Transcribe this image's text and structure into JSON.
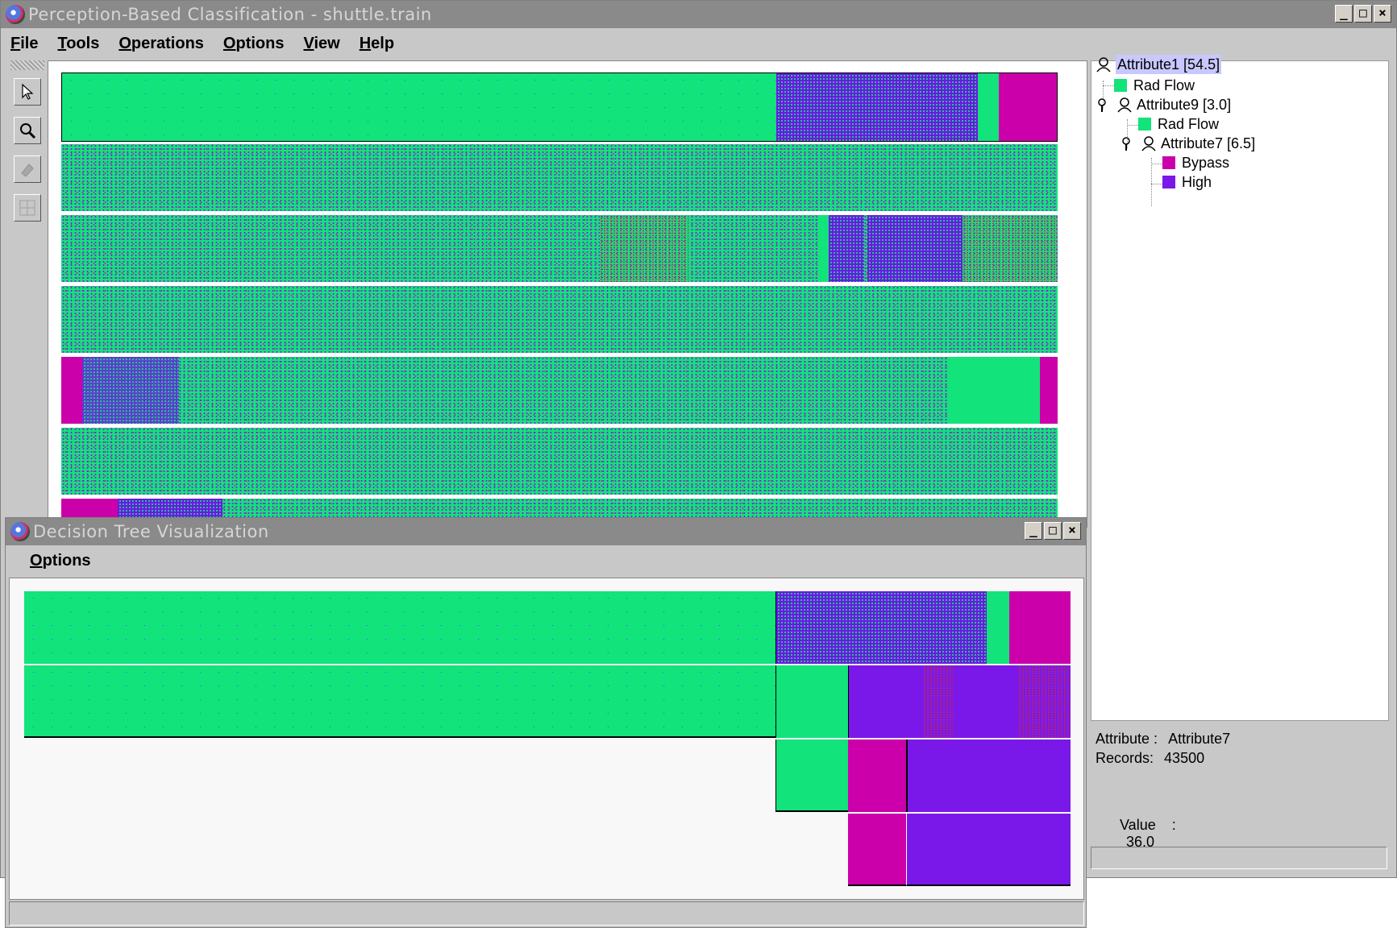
{
  "main_window": {
    "title": "Perception-Based Classification - shuttle.train",
    "menus": [
      "File",
      "Tools",
      "Operations",
      "Options",
      "View",
      "Help"
    ],
    "tools": [
      "pointer-tool",
      "zoom-tool",
      "erase-tool",
      "move-tool"
    ]
  },
  "tree": {
    "nodes": [
      {
        "label": "Attribute1 [54.5]",
        "kind": "split",
        "selected": true
      },
      {
        "label": "Rad Flow",
        "kind": "leaf",
        "color": "#12e37a"
      },
      {
        "label": "Attribute9 [3.0]",
        "kind": "split"
      },
      {
        "label": "Rad Flow",
        "kind": "leaf",
        "color": "#12e37a"
      },
      {
        "label": "Attribute7 [6.5]",
        "kind": "split"
      },
      {
        "label": "Bypass",
        "kind": "leaf",
        "color": "#cc00aa"
      },
      {
        "label": "High",
        "kind": "leaf",
        "color": "#7a18ea"
      }
    ]
  },
  "info_panel": {
    "attribute_label": "Attribute :",
    "attribute_value": "Attribute7",
    "records_label": "Records:",
    "records_value": "43500",
    "value_label": "Value    :",
    "value_value": "36.0"
  },
  "dtv_window": {
    "title": "Decision Tree Visualization",
    "menus": [
      "Options"
    ]
  },
  "colors": {
    "rad_flow": "#12e37a",
    "bypass": "#cc00aa",
    "high": "#7a18ea"
  }
}
